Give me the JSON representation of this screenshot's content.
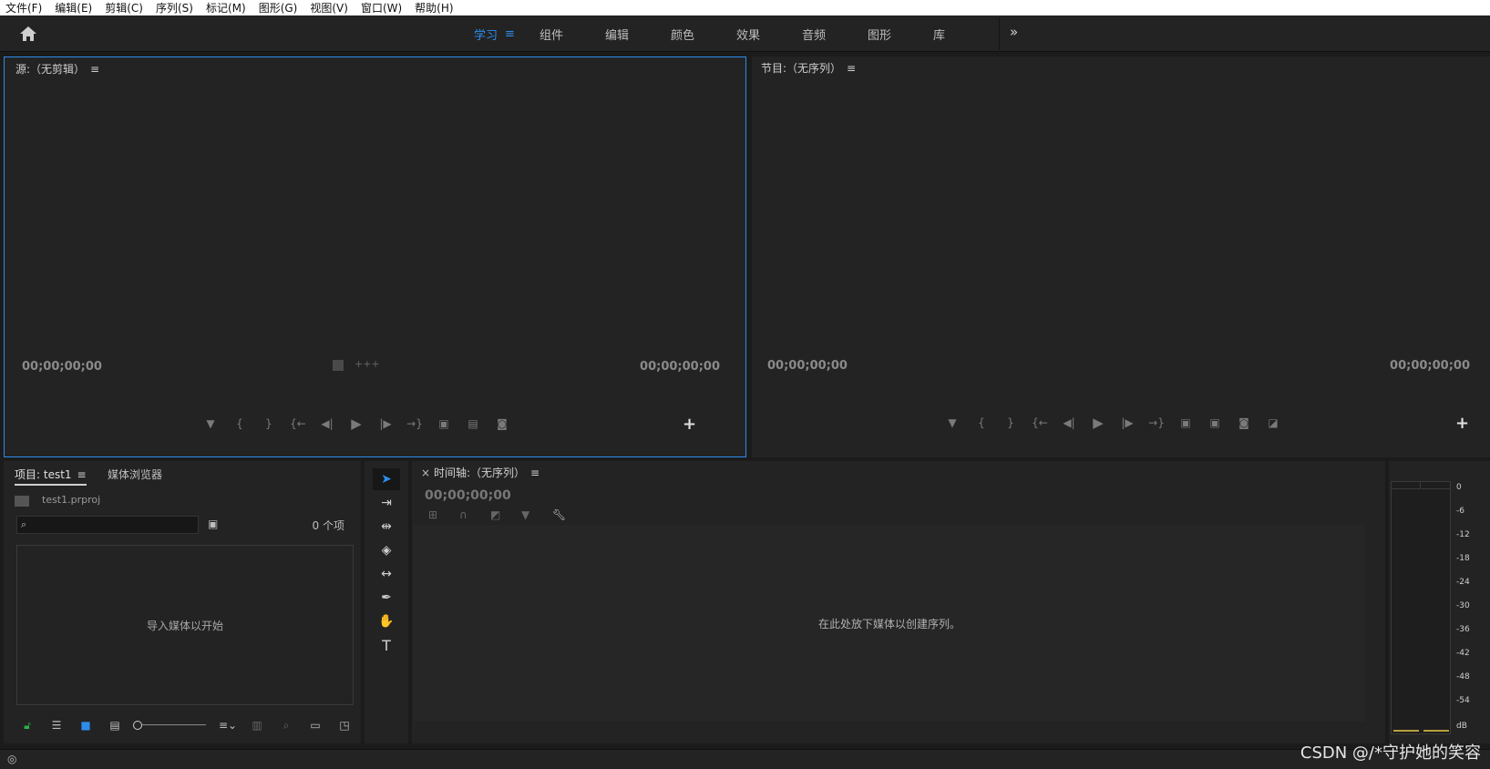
{
  "menubar": {
    "items": [
      "文件(F)",
      "编辑(E)",
      "剪辑(C)",
      "序列(S)",
      "标记(M)",
      "图形(G)",
      "视图(V)",
      "窗口(W)",
      "帮助(H)"
    ]
  },
  "workspaces": {
    "tabs": [
      "学习",
      "组件",
      "编辑",
      "颜色",
      "效果",
      "音频",
      "图形",
      "库"
    ],
    "active": "学习",
    "menu_glyph": "≡",
    "more_glyph": "»"
  },
  "source_monitor": {
    "title": "源:（无剪辑）",
    "timecode_in": "00;00;00;00",
    "timecode_out": "00;00;00;00"
  },
  "program_monitor": {
    "title": "节目:（无序列）",
    "timecode_in": "00;00;00;00",
    "timecode_out": "00;00;00;00"
  },
  "project": {
    "tab_project": "项目: test1",
    "tab_media": "媒体浏览器",
    "file_name": "test1.prproj",
    "item_count": "0 个项",
    "empty_message": "导入媒体以开始"
  },
  "timeline": {
    "title": "时间轴:（无序列）",
    "close_glyph": "×",
    "timecode": "00;00;00;00",
    "empty_message": "在此处放下媒体以创建序列。"
  },
  "meter": {
    "ticks": [
      "0",
      "-6",
      "-12",
      "-18",
      "-24",
      "-30",
      "-36",
      "-42",
      "-48",
      "-54",
      "dB"
    ]
  },
  "watermark": "CSDN @/*守护她的笑容",
  "colors": {
    "accent": "#2d8ceb",
    "panel": "#232323",
    "background": "#1b1b1b"
  }
}
